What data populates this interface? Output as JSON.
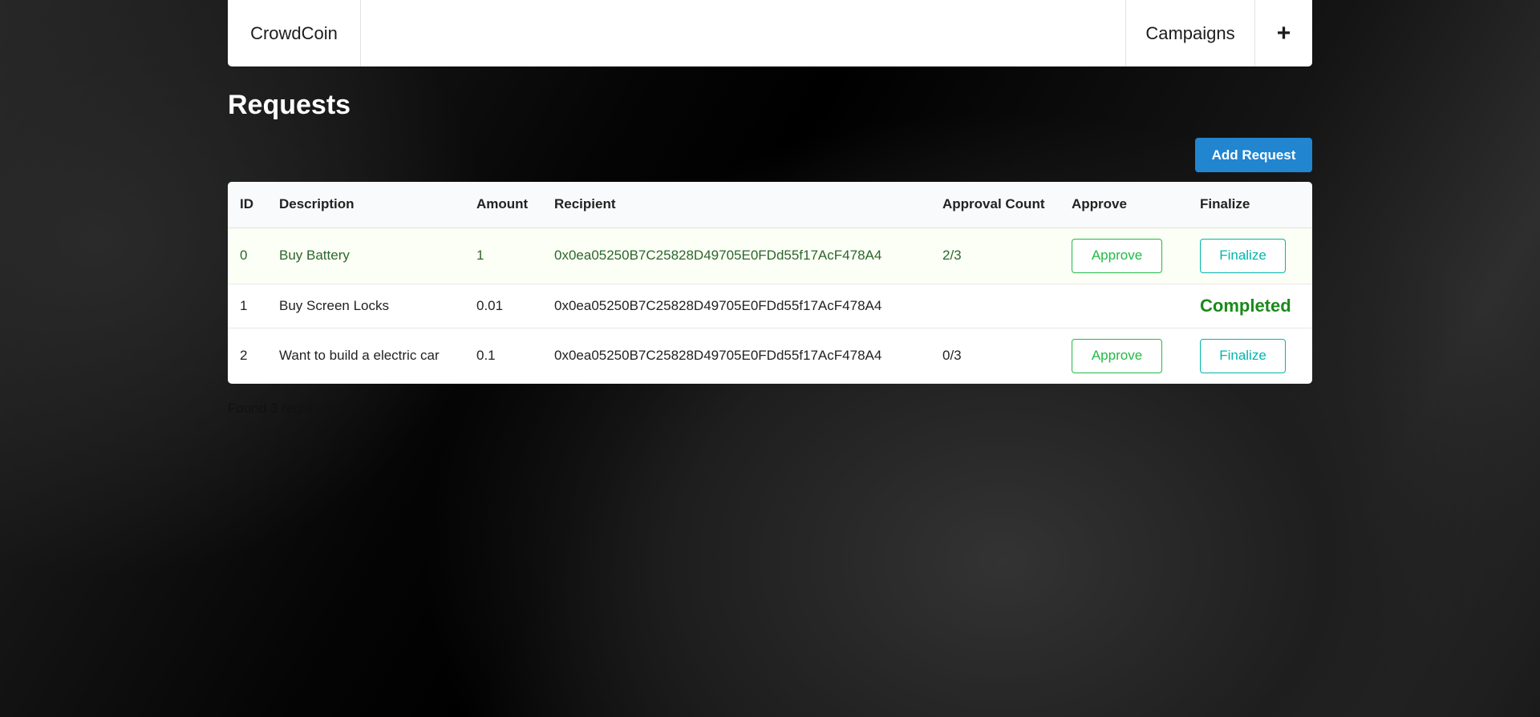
{
  "menu": {
    "brand": "CrowdCoin",
    "campaigns": "Campaigns",
    "plus": "+"
  },
  "page": {
    "title": "Requests",
    "add_button": "Add Request",
    "footer": "Found 3 requests"
  },
  "table": {
    "headers": {
      "id": "ID",
      "description": "Description",
      "amount": "Amount",
      "recipient": "Recipient",
      "approval_count": "Approval Count",
      "approve": "Approve",
      "finalize": "Finalize"
    },
    "rows": [
      {
        "id": "0",
        "description": "Buy Battery",
        "amount": "1",
        "recipient": "0x0ea05250B7C25828D49705E0FDd55f17AcF478A4",
        "approval_count": "2/3",
        "approve_label": "Approve",
        "finalize_label": "Finalize"
      },
      {
        "id": "1",
        "description": "Buy Screen Locks",
        "amount": "0.01",
        "recipient": "0x0ea05250B7C25828D49705E0FDd55f17AcF478A4",
        "approval_count": "",
        "status": "Completed"
      },
      {
        "id": "2",
        "description": "Want to build a electric car",
        "amount": "0.1",
        "recipient": "0x0ea05250B7C25828D49705E0FDd55f17AcF478A4",
        "approval_count": "0/3",
        "approve_label": "Approve",
        "finalize_label": "Finalize"
      }
    ]
  },
  "colors": {
    "primary": "#2185d0",
    "approve": "#21ba45",
    "finalize": "#00b5ad",
    "completed": "#1a8a1a",
    "positive_row_text": "#2c662d"
  }
}
